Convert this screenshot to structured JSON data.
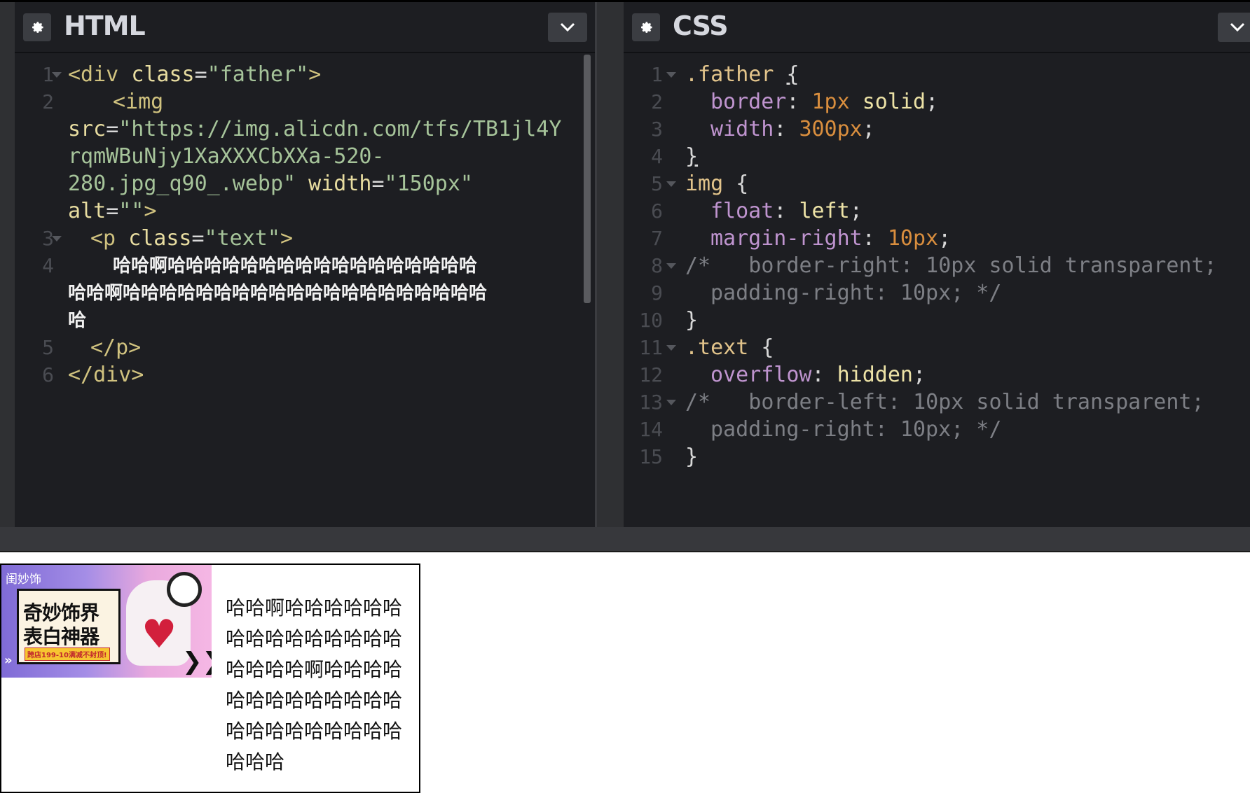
{
  "html_pane": {
    "title": "HTML",
    "gear_icon": "gear-icon",
    "collapse_icon": "chevron-down-icon",
    "lines": {
      "n1": "1",
      "n2": "2",
      "n3": "3",
      "n4": "4",
      "n5": "5",
      "n6": "6",
      "div_open": "<div ",
      "class_attr": "class",
      "eq": "=",
      "father_val": "\"father\"",
      "gt": ">",
      "img_open": "<img",
      "src_attr": "src",
      "src_val_a": "\"https://img.alicdn.com/tfs/TB1jl4Y",
      "src_val_b": "rqmWBuNjy1XaXXXCbXXa-520-",
      "src_val_c": "280.jpg_q90_.webp\"",
      "width_attr": "width",
      "width_val": "\"150px\"",
      "alt_attr": "alt",
      "alt_val": "\"\"",
      "p_open": "<p ",
      "text_val": "\"text\"",
      "cjk_a": "哈哈啊哈哈哈哈哈哈哈哈哈哈哈哈哈哈哈哈哈",
      "cjk_b": "哈哈啊哈哈哈哈哈哈哈哈哈哈哈哈哈哈哈哈哈哈哈哈",
      "cjk_c": "哈",
      "p_close": "</p>",
      "div_close": "</div>"
    }
  },
  "css_pane": {
    "title": "CSS",
    "gear_icon": "gear-icon",
    "collapse_icon": "chevron-down-icon",
    "lines": {
      "n1": "1",
      "n2": "2",
      "n3": "3",
      "n4": "4",
      "n5": "5",
      "n6": "6",
      "n7": "7",
      "n8": "8",
      "n9": "9",
      "n10": "10",
      "n11": "11",
      "n12": "12",
      "n13": "13",
      "n14": "14",
      "n15": "15",
      "father_sel": ".father",
      "ob": "{",
      "cb": "}",
      "border_prop": "border",
      "colon": ":",
      "semi": ";",
      "onepx": "1px",
      "solid": "solid",
      "width_prop": "width",
      "threehundred": "300px",
      "img_sel": "img",
      "float_prop": "float",
      "left_kw": "left",
      "margin_prop": "margin-right",
      "tenpx": "10px",
      "comment_8": "/*   border-right: 10px solid transparent;",
      "comment_9": "padding-right: 10px; */",
      "text_sel": ".text",
      "overflow_prop": "overflow",
      "hidden_kw": "hidden",
      "comment_13": "/*   border-left: 10px solid transparent;",
      "comment_14": "padding-right: 10px; */"
    }
  },
  "preview": {
    "banner": {
      "brand": "闺妙饰",
      "line1": "奇妙饰界",
      "line2": "表白神器",
      "tag": "跨店199-10满减不封顶!",
      "arrow_right": "❯❯",
      "arrow_left": "»"
    },
    "paragraph": "哈哈啊哈哈哈哈哈哈哈哈哈哈哈哈哈哈哈哈哈哈哈啊哈哈哈哈哈哈哈哈哈哈哈哈哈哈哈哈哈哈哈哈哈哈哈哈哈"
  },
  "colors": {
    "editor_bg": "#1d1e22",
    "tag": "#d0c27f",
    "string": "#a6c49a",
    "property": "#bf94cf",
    "number": "#d98e3e",
    "comment": "#7d7f85"
  }
}
